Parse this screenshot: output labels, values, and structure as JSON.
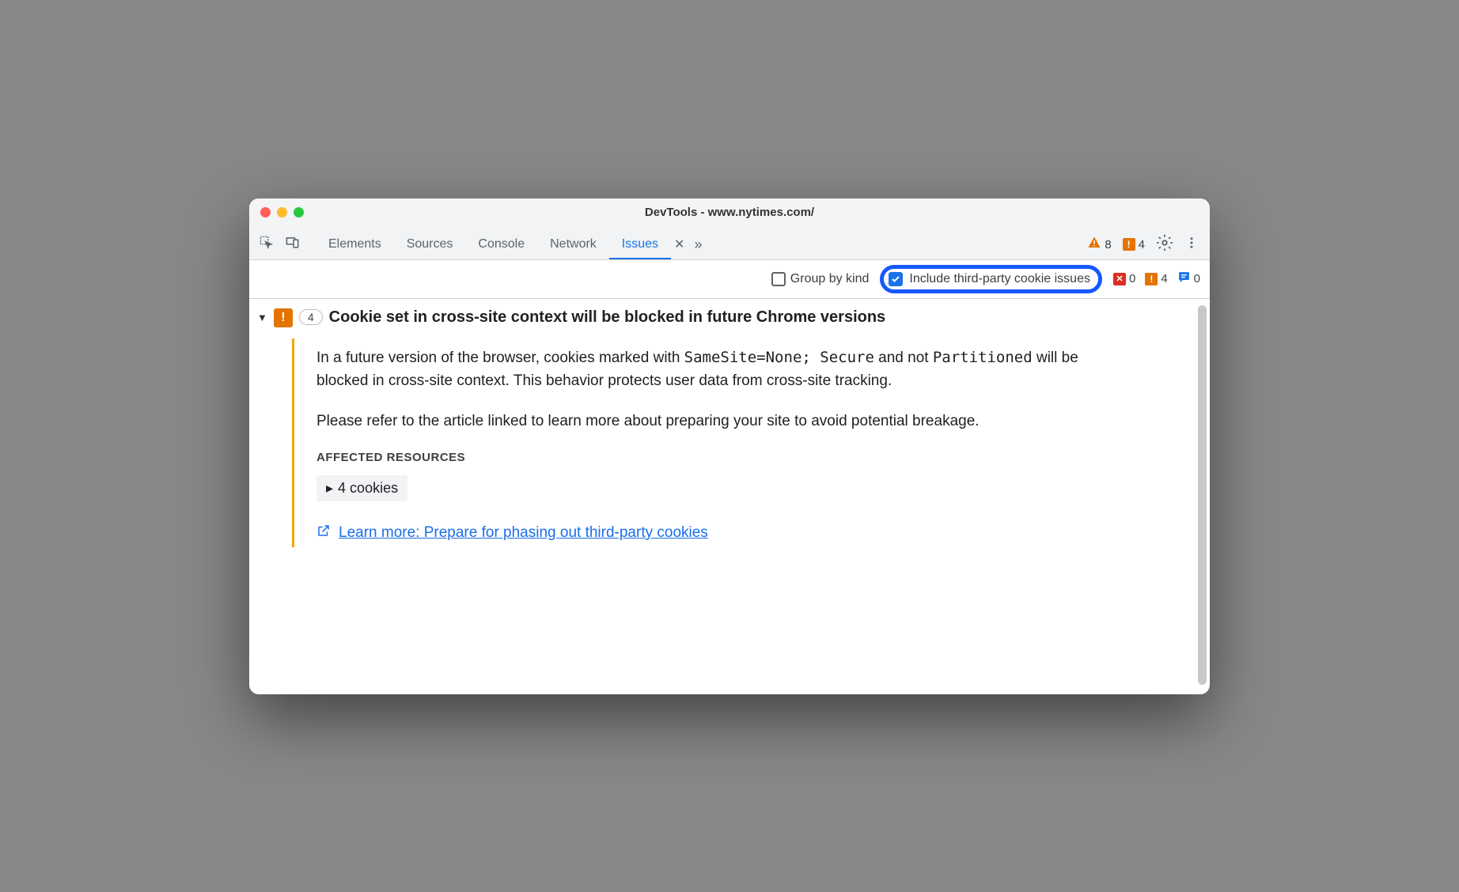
{
  "window": {
    "title": "DevTools - www.nytimes.com/"
  },
  "tabs": {
    "elements": "Elements",
    "sources": "Sources",
    "console": "Console",
    "network": "Network",
    "issues": "Issues"
  },
  "toolbarBadges": {
    "warnTriCount": "8",
    "warnSqCount": "4"
  },
  "filter": {
    "groupByKind": "Group by kind",
    "includeThirdParty": "Include third-party cookie issues"
  },
  "kindCounts": {
    "red": "0",
    "orange": "4",
    "blue": "0"
  },
  "issue": {
    "count": "4",
    "title": "Cookie set in cross-site context will be blocked in future Chrome versions",
    "p1_a": "In a future version of the browser, cookies marked with ",
    "code1": "SameSite=None; Secure",
    "p1_b": " and not ",
    "code2": "Partitioned",
    "p1_c": " will be blocked in cross-site context. This behavior protects user data from cross-site tracking.",
    "p2": "Please refer to the article linked to learn more about preparing your site to avoid potential breakage.",
    "affectedHeading": "AFFECTED RESOURCES",
    "cookiesExpand": "4 cookies",
    "learnMore": "Learn more: Prepare for phasing out third-party cookies"
  }
}
